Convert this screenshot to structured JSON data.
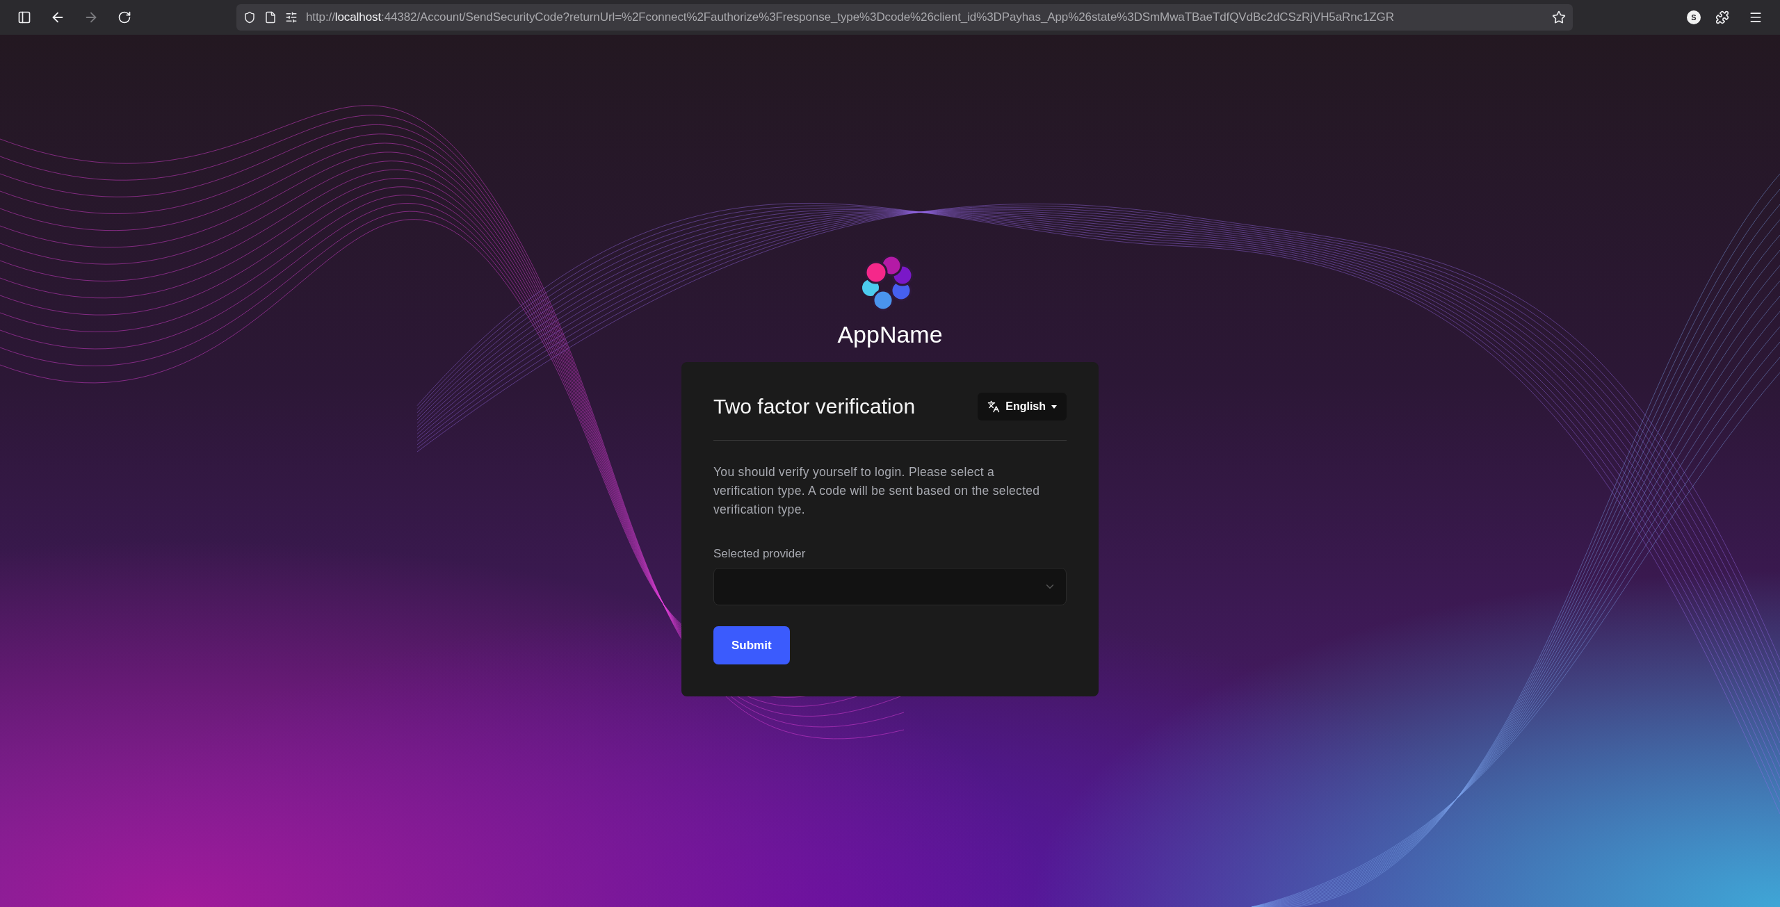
{
  "browser": {
    "back_disabled": false,
    "forward_disabled": true,
    "url": {
      "scheme": "http://",
      "host": "localhost",
      "rest": ":44382/Account/SendSecurityCode?returnUrl=%2Fconnect%2Fauthorize%3Fresponse_type%3Dcode%26client_id%3DPayhas_App%26state%3DSmMwaTBaeTdfQVdBc2dCSzRjVH5aRnc1ZGR"
    },
    "profile_initial": "S"
  },
  "brand": {
    "name": "AppName"
  },
  "card": {
    "title": "Two factor verification",
    "language": "English",
    "description": "You should verify yourself to login. Please select a verification type. A code will be sent based on the selected verification type.",
    "provider_label": "Selected provider",
    "submit": "Submit"
  }
}
